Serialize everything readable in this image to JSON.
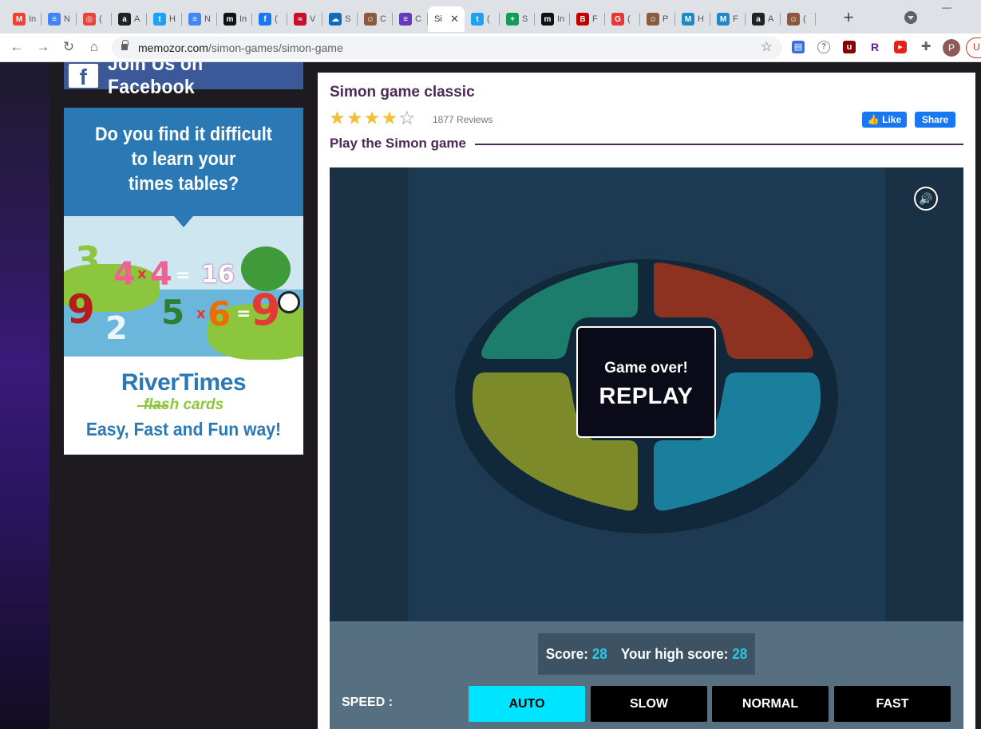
{
  "browser": {
    "tabs": [
      {
        "icon": "gmail-icon",
        "color": "#ea4335",
        "glyph": "M",
        "label": "In"
      },
      {
        "icon": "google-docs-icon",
        "color": "#4285f4",
        "glyph": "≡",
        "label": "N"
      },
      {
        "icon": "circle-app-icon",
        "color": "#e8453c",
        "glyph": "◎",
        "label": "("
      },
      {
        "icon": "amazon-icon",
        "color": "#222222",
        "glyph": "a",
        "label": "A"
      },
      {
        "icon": "twitter-icon",
        "color": "#1da1f2",
        "glyph": "t",
        "label": "H"
      },
      {
        "icon": "google-docs-icon",
        "color": "#4285f4",
        "glyph": "≡",
        "label": "N"
      },
      {
        "icon": "ms-icon",
        "color": "#111111",
        "glyph": "m",
        "label": "In"
      },
      {
        "icon": "facebook-icon",
        "color": "#1877f2",
        "glyph": "f",
        "label": "("
      },
      {
        "icon": "flag-icon",
        "color": "#c8102e",
        "glyph": "≈",
        "label": "V"
      },
      {
        "icon": "cloud-icon",
        "color": "#0f6cbd",
        "glyph": "☁",
        "label": "S"
      },
      {
        "icon": "avatar-icon",
        "color": "#8b5a3c",
        "glyph": "☺",
        "label": "C"
      },
      {
        "icon": "forms-icon",
        "color": "#673ab7",
        "glyph": "≡",
        "label": "C"
      },
      {
        "icon": "twitter-icon",
        "color": "#1da1f2",
        "glyph": "t",
        "label": "("
      },
      {
        "icon": "sheets-icon",
        "color": "#0f9d58",
        "glyph": "+",
        "label": "S"
      },
      {
        "icon": "ms-icon",
        "color": "#111111",
        "glyph": "m",
        "label": "In"
      },
      {
        "icon": "b-icon",
        "color": "#c20000",
        "glyph": "B",
        "label": "F"
      },
      {
        "icon": "g-icon",
        "color": "#e53935",
        "glyph": "G",
        "label": "("
      },
      {
        "icon": "avatar-icon",
        "color": "#8b5a3c",
        "glyph": "☺",
        "label": "P"
      },
      {
        "icon": "mo-icon",
        "color": "#1e88c8",
        "glyph": "M",
        "label": "H"
      },
      {
        "icon": "mo-icon",
        "color": "#1e88c8",
        "glyph": "M",
        "label": "F"
      },
      {
        "icon": "amazon-icon",
        "color": "#222222",
        "glyph": "a",
        "label": "A"
      },
      {
        "icon": "avatar-icon",
        "color": "#8b5a3c",
        "glyph": "☺",
        "label": "("
      }
    ],
    "active_tab": {
      "label": "Si",
      "icon": "chrome-icon"
    },
    "url_host": "memozor.com",
    "url_path": "/simon-games/simon-game",
    "profile_initial": "P",
    "update_label": "U"
  },
  "sidebar": {
    "facebook_banner": "Join Us on Facebook",
    "facebook_glyph": "f",
    "ad": {
      "question_line1": "Do you find it difficult",
      "question_line2": "to learn your",
      "question_line3": "times tables?",
      "brand": "RiverTimes",
      "sub_brand": "flash cards",
      "tagline": "Easy, Fast and Fun way!"
    }
  },
  "main": {
    "title": "Simon game classic",
    "rating": 4,
    "rating_max": 5,
    "reviews": "1877 Reviews",
    "like_label": "Like",
    "share_label": "Share",
    "subtitle": "Play the Simon game",
    "game": {
      "colors": {
        "green": "#1d7d6c",
        "red": "#8d3221",
        "yellow": "#7d8a2a",
        "blue": "#1a7f9c",
        "ring": "#11273a"
      },
      "game_over": "Game over!",
      "replay": "REPLAY"
    },
    "score_label": "Score:",
    "score": "28",
    "high_score_label": "Your high score:",
    "high_score": "28",
    "speed_label": "SPEED :",
    "speeds": [
      "AUTO",
      "SLOW",
      "NORMAL",
      "FAST"
    ],
    "speed_selected": "AUTO"
  }
}
